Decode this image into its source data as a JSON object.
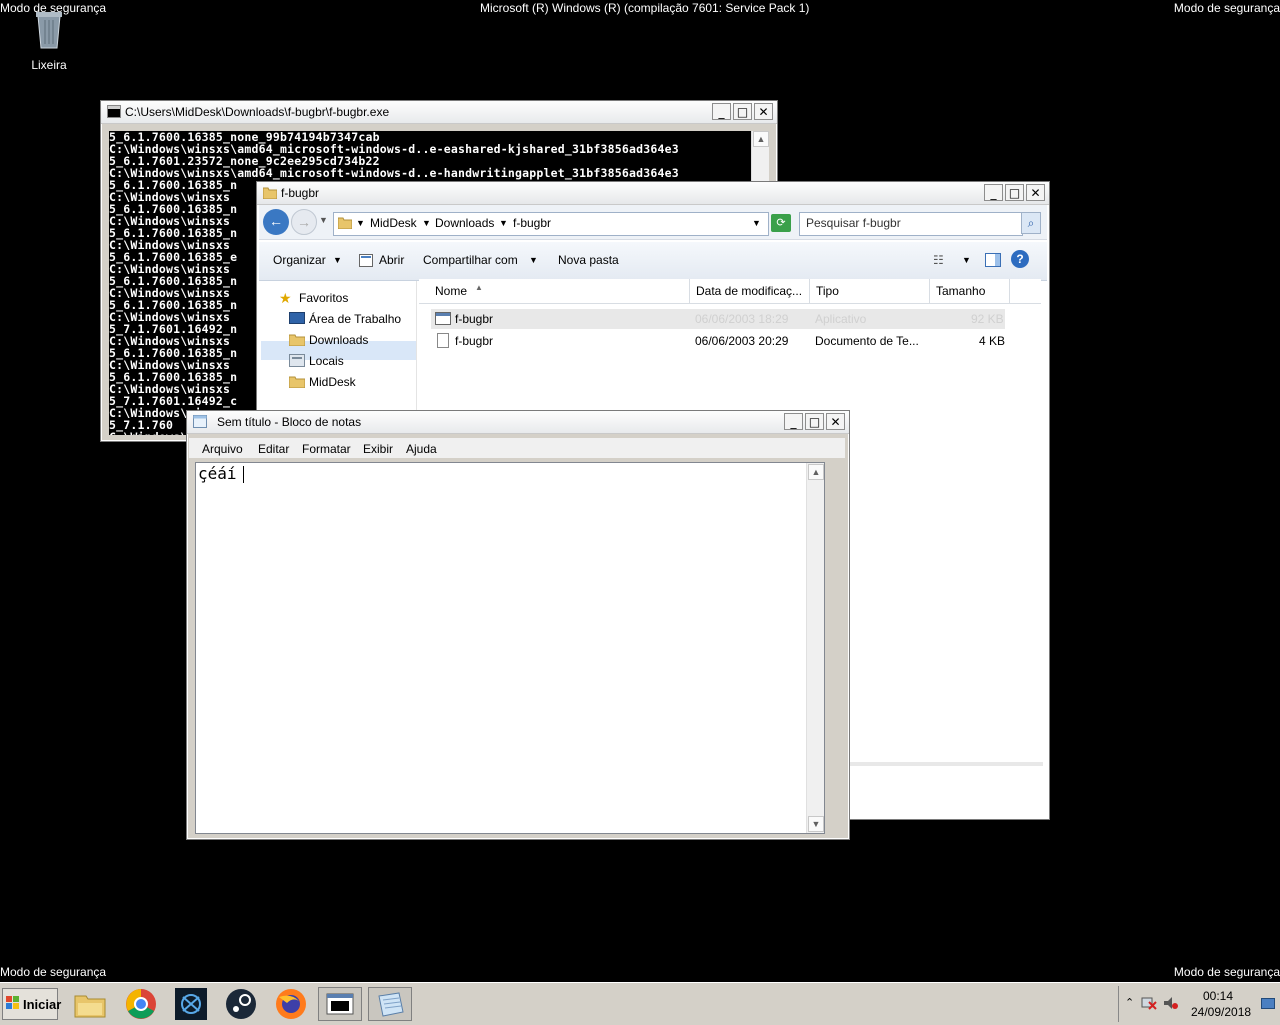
{
  "desktop": {
    "safe_mode_label": "Modo de segurança",
    "os_build": "Microsoft (R) Windows (R) (compilação 7601: Service Pack 1)",
    "recycle_bin_label": "Lixeira"
  },
  "console": {
    "title": "C:\\Users\\MidDesk\\Downloads\\f-bugbr\\f-bugbr.exe",
    "lines": [
      "5_6.1.7600.16385_none_99b74194b7347cab",
      "C:\\Windows\\winsxs\\amd64_microsoft-windows-d..e-eashared-kjshared_31bf3856ad364e3",
      "5_6.1.7601.23572_none_9c2ee295cd734b22",
      "C:\\Windows\\winsxs\\amd64_microsoft-windows-d..e-handwritingapplet_31bf3856ad364e3",
      "5_6.1.7600.16385_n",
      "C:\\Windows\\winsxs",
      "5_6.1.7600.16385_n",
      "C:\\Windows\\winsxs",
      "5_6.1.7600.16385_n",
      "C:\\Windows\\winsxs",
      "5_6.1.7600.16385_e",
      "C:\\Windows\\winsxs",
      "5_6.1.7600.16385_n",
      "C:\\Windows\\winsxs",
      "5_6.1.7600.16385_n",
      "C:\\Windows\\winsxs",
      "5_7.1.7601.16492_n",
      "C:\\Windows\\winsxs",
      "5_6.1.7600.16385_n",
      "C:\\Windows\\winsxs",
      "5_6.1.7600.16385_n",
      "C:\\Windows\\winsxs",
      "5_7.1.7601.16492_c",
      "C:\\Windows\\winsxs",
      "5_7.1.760",
      "C:\\Windows\\winsxs",
      "C:\\Windows"
    ]
  },
  "explorer": {
    "title": "f-bugbr",
    "breadcrumb": [
      "MidDesk",
      "Downloads",
      "f-bugbr"
    ],
    "search_placeholder": "Pesquisar f-bugbr",
    "toolbar": {
      "organize": "Organizar",
      "open": "Abrir",
      "share": "Compartilhar com",
      "new_folder": "Nova pasta"
    },
    "nav": {
      "favorites": "Favoritos",
      "items": [
        "Área de Trabalho",
        "Downloads",
        "Locais",
        "MidDesk"
      ]
    },
    "columns": [
      "Nome",
      "Data de modificaç...",
      "Tipo",
      "Tamanho"
    ],
    "files": [
      {
        "name": "f-bugbr",
        "date": "06/06/2003 18:29",
        "type": "Aplicativo",
        "size": "92 KB"
      },
      {
        "name": "f-bugbr",
        "date": "06/06/2003 20:29",
        "type": "Documento de Te...",
        "size": "4 KB"
      }
    ]
  },
  "notepad": {
    "title": "Sem título - Bloco de notas",
    "menu": [
      "Arquivo",
      "Editar",
      "Formatar",
      "Exibir",
      "Ajuda"
    ],
    "content": "çéáí"
  },
  "taskbar": {
    "start_label": "Iniciar",
    "time": "00:14",
    "date": "24/09/2018"
  },
  "colors": {
    "desktop": "#000000",
    "window_chrome": "#d4d0c8",
    "selection": "#d9e7f8",
    "explorer_toolbar": "#e4eaf2"
  }
}
